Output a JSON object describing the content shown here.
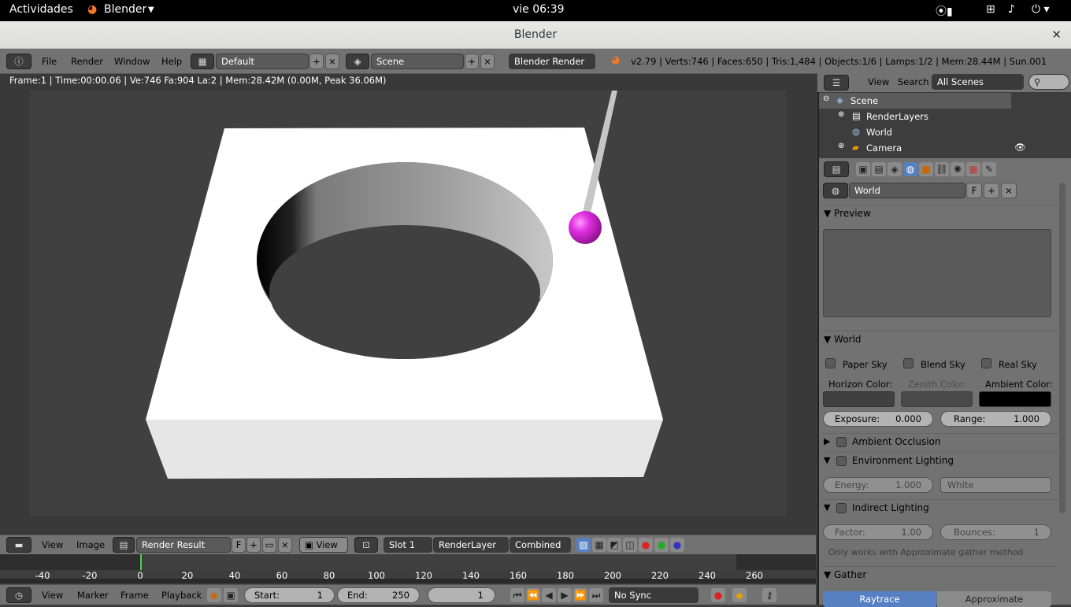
{
  "gnome": {
    "activities": "Actividades",
    "app": "Blender",
    "clock": "vie 06:39"
  },
  "window": {
    "title": "Blender"
  },
  "menu": {
    "file": "File",
    "render": "Render",
    "window": "Window",
    "help": "Help",
    "layout": "Default",
    "scene": "Scene",
    "engine": "Blender Render",
    "stats": "v2.79 | Verts:746 | Faces:650 | Tris:1,484 | Objects:1/6 | Lamps:1/2 | Mem:28.44M | Sun.001"
  },
  "image_editor": {
    "info": "Frame:1 | Time:00:00.06 | Ve:746 Fa:904 La:2 | Mem:28.42M (0.00M, Peak 36.06M)",
    "view": "View",
    "image": "Image",
    "image_name": "Render Result",
    "fake": "F",
    "view2": "View",
    "slot": "Slot 1",
    "layer": "RenderLayer",
    "pass": "Combined"
  },
  "timeline": {
    "ticks": [
      "-40",
      "-20",
      "0",
      "20",
      "40",
      "60",
      "80",
      "100",
      "120",
      "140",
      "160",
      "180",
      "200",
      "220",
      "240",
      "260"
    ],
    "view": "View",
    "marker": "Marker",
    "frame": "Frame",
    "playback": "Playback",
    "start_label": "Start:",
    "start": "1",
    "end_label": "End:",
    "end": "250",
    "current": "1",
    "sync": "No Sync"
  },
  "outliner": {
    "view": "View",
    "search": "Search",
    "scenes": "All Scenes",
    "items": [
      "Scene",
      "RenderLayers",
      "World",
      "Camera"
    ]
  },
  "properties": {
    "world_name": "World",
    "fake": "F",
    "preview": "Preview",
    "world_panel": "World",
    "paper_sky": "Paper Sky",
    "blend_sky": "Blend Sky",
    "real_sky": "Real Sky",
    "horizon": "Horizon Color:",
    "zenith": "Zenith Color:",
    "ambient": "Ambient Color:",
    "exposure_label": "Exposure:",
    "exposure": "0.000",
    "range_label": "Range:",
    "range": "1.000",
    "ao": "Ambient Occlusion",
    "env": "Environment Lighting",
    "energy_label": "Energy:",
    "energy": "1.000",
    "env_color": "White",
    "indirect": "Indirect Lighting",
    "factor_label": "Factor:",
    "factor": "1.00",
    "bounces_label": "Bounces:",
    "bounces": "1",
    "note": "Only works with Approximate gather method",
    "gather": "Gather",
    "raytrace": "Raytrace",
    "approximate": "Approximate"
  },
  "colors": {
    "horizon": "#404040",
    "zenith": "#404040",
    "ambient": "#000000",
    "accent": "#5680c2",
    "sphere": "#d628d6"
  }
}
